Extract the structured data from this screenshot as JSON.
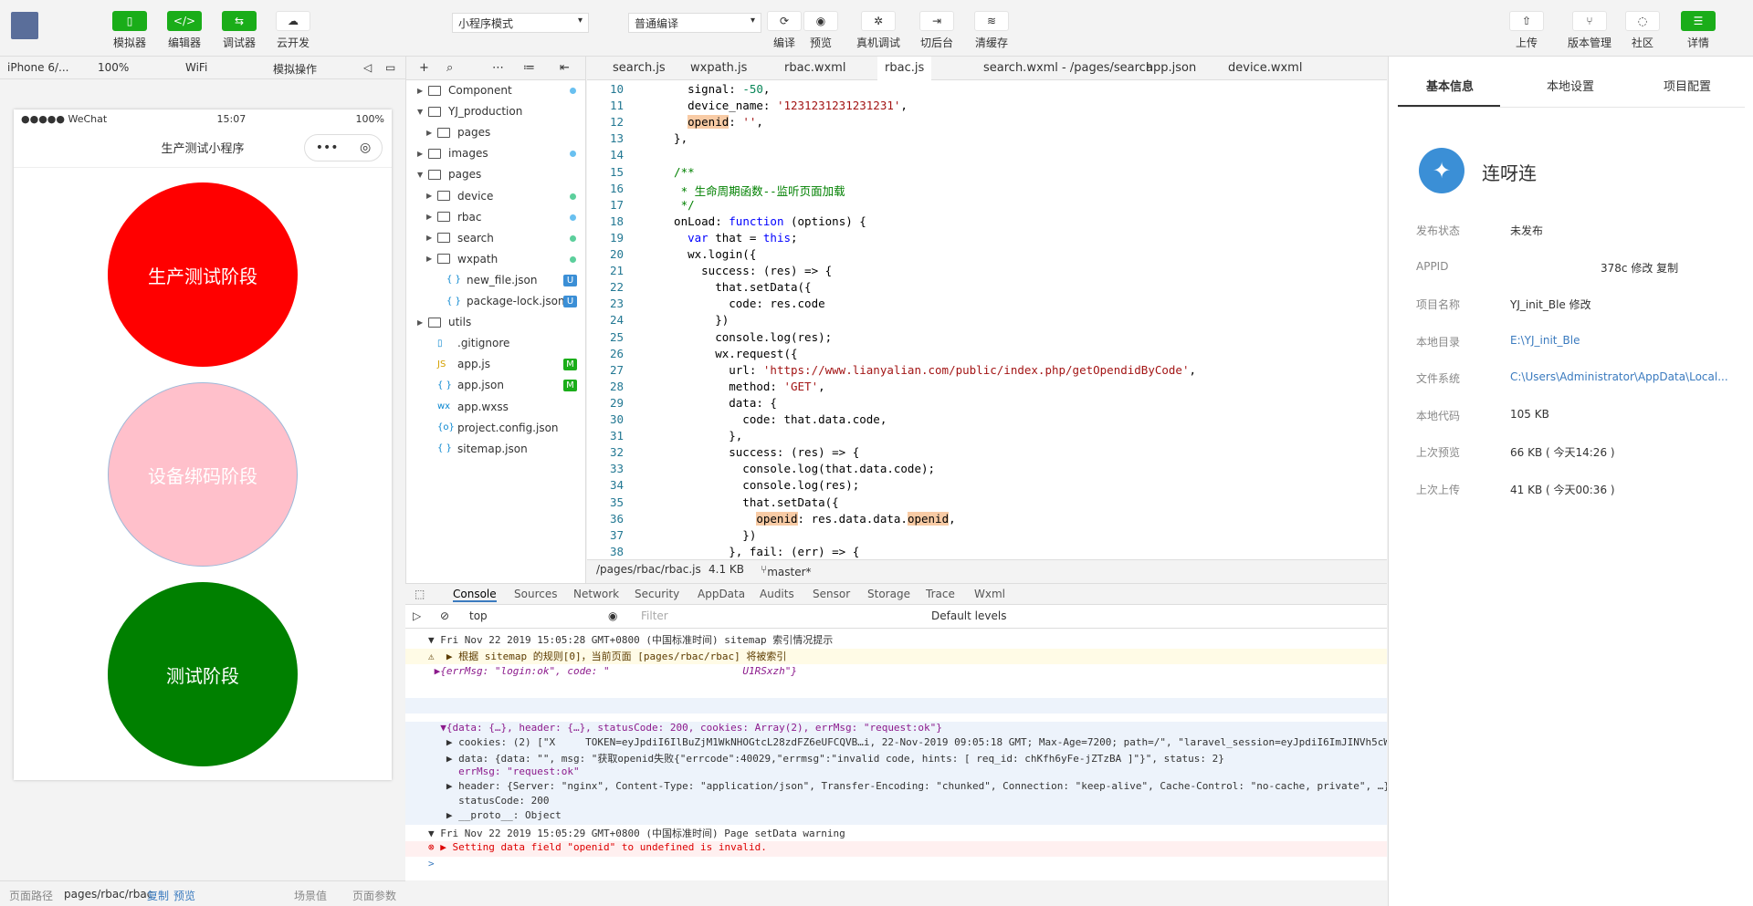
{
  "toolbar": {
    "simulator": "模拟器",
    "editor": "编辑器",
    "debugger": "调试器",
    "cloud": "云开发",
    "mode": "小程序模式",
    "compile_mode": "普通编译",
    "compile": "编译",
    "preview": "预览",
    "remote_debug": "真机调试",
    "backstage": "切后台",
    "clear_cache": "清缓存",
    "upload": "上传",
    "version": "版本管理",
    "community": "社区",
    "details": "详情"
  },
  "simbar": {
    "device": "iPhone 6/...",
    "zoom": "100%",
    "network": "WiFi",
    "sim_op": "模拟操作"
  },
  "phone": {
    "carrier": "●●●●● WeChat",
    "time": "15:07",
    "battery": "100%",
    "title": "生产测试小程序",
    "btn1": "生产测试阶段",
    "btn2": "设备绑码阶段",
    "btn3": "测试阶段"
  },
  "simfoot": {
    "path_label": "页面路径",
    "path": "pages/rbac/rbac",
    "copy": "复制",
    "preview": "预览",
    "scene": "场景值",
    "params": "页面参数"
  },
  "tree": [
    {
      "name": "Component",
      "type": "folder",
      "open": false,
      "indent": 0,
      "status": "dot-blue"
    },
    {
      "name": "YJ_production",
      "type": "folder",
      "open": true,
      "indent": 0,
      "status": ""
    },
    {
      "name": "pages",
      "type": "folder",
      "open": false,
      "indent": 1,
      "status": ""
    },
    {
      "name": "images",
      "type": "folder",
      "open": false,
      "indent": 0,
      "status": "dot-blue"
    },
    {
      "name": "pages",
      "type": "folder",
      "open": true,
      "indent": 0,
      "status": ""
    },
    {
      "name": "device",
      "type": "folder",
      "open": false,
      "indent": 1,
      "status": "dot-green"
    },
    {
      "name": "rbac",
      "type": "folder",
      "open": false,
      "indent": 1,
      "status": "dot-blue"
    },
    {
      "name": "search",
      "type": "folder",
      "open": false,
      "indent": 1,
      "status": "dot-green"
    },
    {
      "name": "wxpath",
      "type": "folder",
      "open": false,
      "indent": 1,
      "status": "dot-green"
    },
    {
      "name": "new_file.json",
      "type": "json",
      "indent": 2,
      "status": "U"
    },
    {
      "name": "package-lock.json",
      "type": "json",
      "indent": 2,
      "status": "U"
    },
    {
      "name": "utils",
      "type": "folder",
      "open": false,
      "indent": 0,
      "status": ""
    },
    {
      "name": ".gitignore",
      "type": "file",
      "indent": 1,
      "status": ""
    },
    {
      "name": "app.js",
      "type": "js",
      "indent": 1,
      "status": "M"
    },
    {
      "name": "app.json",
      "type": "json",
      "indent": 1,
      "status": "M"
    },
    {
      "name": "app.wxss",
      "type": "wxss",
      "indent": 1,
      "status": ""
    },
    {
      "name": "project.config.json",
      "type": "cfg",
      "indent": 1,
      "status": ""
    },
    {
      "name": "sitemap.json",
      "type": "json",
      "indent": 1,
      "status": ""
    }
  ],
  "tabs": [
    "search.js",
    "wxpath.js",
    "rbac.wxml",
    "rbac.js",
    "search.wxml - /pages/search",
    "app.json",
    "device.wxml"
  ],
  "code_lines": [
    {
      "n": "10",
      "t": "    signal: -50,"
    },
    {
      "n": "11",
      "t": "    device_name: '1231231231231231',"
    },
    {
      "n": "12",
      "t": "    openid: '',"
    },
    {
      "n": "13",
      "t": "  },"
    },
    {
      "n": "14",
      "t": ""
    },
    {
      "n": "15",
      "t": "  /**"
    },
    {
      "n": "16",
      "t": "   * 生命周期函数--监听页面加载"
    },
    {
      "n": "17",
      "t": "   */"
    },
    {
      "n": "18",
      "t": "  onLoad: function (options) {"
    },
    {
      "n": "19",
      "t": "    var that = this;"
    },
    {
      "n": "20",
      "t": "    wx.login({"
    },
    {
      "n": "21",
      "t": "      success: (res) => {"
    },
    {
      "n": "22",
      "t": "        that.setData({"
    },
    {
      "n": "23",
      "t": "          code: res.code"
    },
    {
      "n": "24",
      "t": "        })"
    },
    {
      "n": "25",
      "t": "        console.log(res);"
    },
    {
      "n": "26",
      "t": "        wx.request({"
    },
    {
      "n": "27",
      "t": "          url: 'https://www.lianyalian.com/public/index.php/getOpendidByCode',"
    },
    {
      "n": "28",
      "t": "          method: 'GET',"
    },
    {
      "n": "29",
      "t": "          data: {"
    },
    {
      "n": "30",
      "t": "            code: that.data.code,"
    },
    {
      "n": "31",
      "t": "          },"
    },
    {
      "n": "32",
      "t": "          success: (res) => {"
    },
    {
      "n": "33",
      "t": "            console.log(that.data.code);"
    },
    {
      "n": "34",
      "t": "            console.log(res);"
    },
    {
      "n": "35",
      "t": "            that.setData({"
    },
    {
      "n": "36",
      "t": "              openid: res.data.data.openid,"
    },
    {
      "n": "37",
      "t": "            })"
    },
    {
      "n": "38",
      "t": "          }, fail: (err) => {"
    }
  ],
  "edfoot": {
    "path": "/pages/rbac/rbac.js",
    "size": "4.1 KB",
    "branch": "master*"
  },
  "console_tabs": [
    "Console",
    "Sources",
    "Network",
    "Security",
    "AppData",
    "Audits",
    "Sensor",
    "Storage",
    "Trace",
    "Wxml"
  ],
  "console_bar": {
    "context": "top",
    "filter": "Filter",
    "levels": "Default levels"
  },
  "console_lines": [
    "▼ Fri Nov 22 2019 15:05:28 GMT+0800 (中国标准时间) sitemap 索引情况提示",
    "⚠  ▶ 根据 sitemap 的规则[0]，当前页面 [pages/rbac/rbac] 将被索引",
    " ▶{errMsg: \"login:ok\", code: \"                      U1RSxzh\"}",
    "",
    "",
    "  ▼{data: {…}, header: {…}, statusCode: 200, cookies: Array(2), errMsg: \"request:ok\"}",
    "   ▶ cookies: (2) [\"X     TOKEN=eyJpdiI6IlBuZjM1WkNHOGtcL28zdFZ6eUFCQVB…i, 22-Nov-2019 09:05:18 GMT; Max-Age=7200; path=/\", \"laravel_session=eyJpdiI6ImJINVh5cWJQS",
    "   ▶ data: {data: \"\", msg: \"获取openid失败{\"errcode\":40029,\"errmsg\":\"invalid code, hints: [ req_id: chKfh6yFe-jZTzBA ]\"}\", status: 2}",
    "     errMsg: \"request:ok\"",
    "   ▶ header: {Server: \"nginx\", Content-Type: \"application/json\", Transfer-Encoding: \"chunked\", Connection: \"keep-alive\", Cache-Control: \"no-cache, private\", …}",
    "     statusCode: 200",
    "   ▶ __proto__: Object",
    "▼ Fri Nov 22 2019 15:05:29 GMT+0800 (中国标准时间) Page setData warning",
    "⊗ ▶ Setting data field \"openid\" to undefined is invalid.",
    ">"
  ],
  "right": {
    "tab1": "基本信息",
    "tab2": "本地设置",
    "tab3": "项目配置",
    "app_name": "连呀连",
    "rows": [
      {
        "k": "发布状态",
        "v": "未发布"
      },
      {
        "k": "APPID",
        "v": "378c 修改 复制"
      },
      {
        "k": "项目名称",
        "v": "YJ_init_Ble 修改"
      },
      {
        "k": "本地目录",
        "v": "E:\\YJ_init_Ble"
      },
      {
        "k": "文件系统",
        "v": "C:\\Users\\Administrator\\AppData\\Local..."
      },
      {
        "k": "本地代码",
        "v": "105 KB"
      },
      {
        "k": "上次预览",
        "v": "66 KB ( 今天14:26 )"
      },
      {
        "k": "上次上传",
        "v": "41 KB ( 今天00:36 )"
      }
    ]
  },
  "colors": {
    "green": "#1aad19",
    "red": "#ff0000",
    "pink": "#ffc0cb",
    "dark_green": "#008000"
  }
}
